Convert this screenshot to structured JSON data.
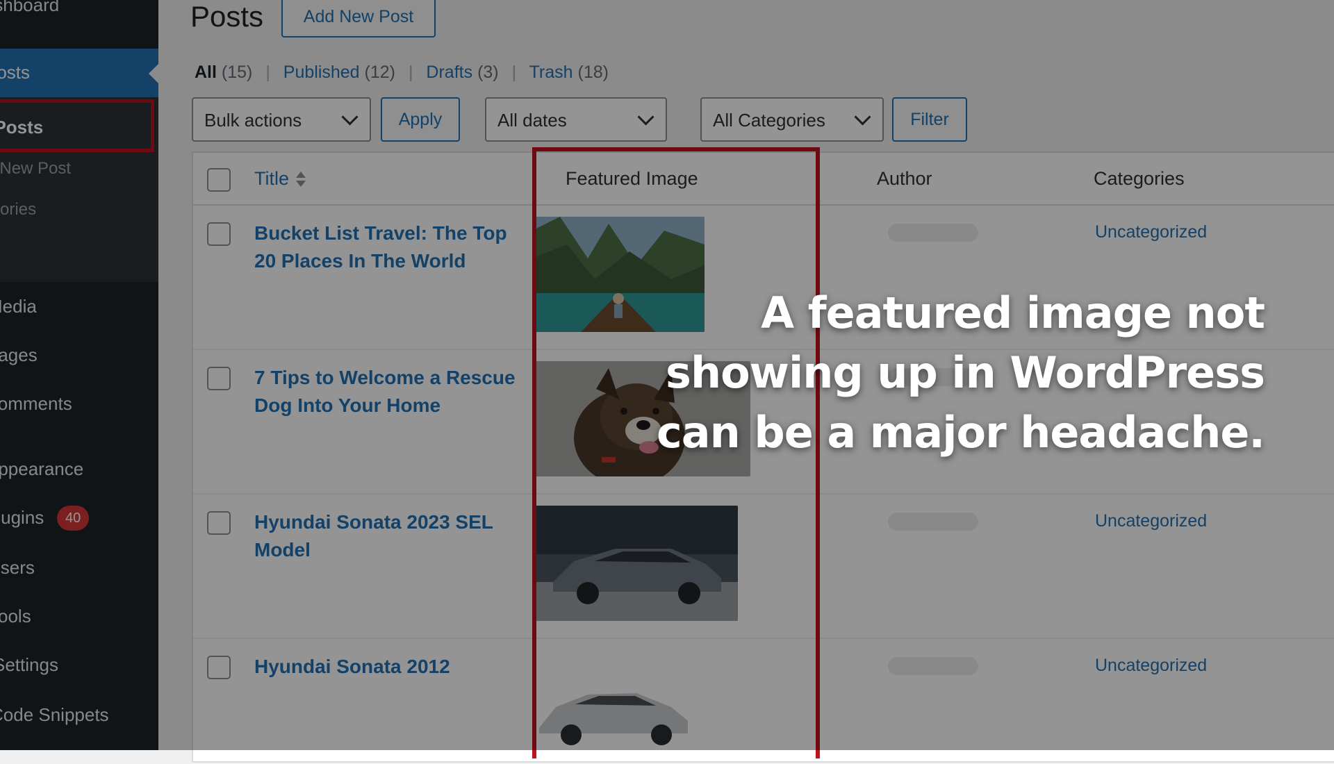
{
  "sidebar": {
    "dashboard": "Dashboard",
    "posts": "Posts",
    "all_posts": "All Posts",
    "add_new_post": "Add New Post",
    "categories": "Categories",
    "media": "Media",
    "pages": "Pages",
    "comments": "Comments",
    "appearance": "Appearance",
    "plugins": "Plugins",
    "plugins_badge": "40",
    "users": "Users",
    "tools": "Tools",
    "settings": "Settings",
    "code_snippets": "Code Snippets"
  },
  "header": {
    "title": "Posts",
    "add_new": "Add New Post"
  },
  "filters": {
    "all": "All",
    "all_count": "(15)",
    "published": "Published",
    "published_count": "(12)",
    "drafts": "Drafts",
    "drafts_count": "(3)",
    "trash": "Trash",
    "trash_count": "(18)",
    "sep": "|"
  },
  "toolbar": {
    "bulk_actions": "Bulk actions",
    "apply": "Apply",
    "all_dates": "All dates",
    "all_categories": "All Categories",
    "filter": "Filter"
  },
  "table": {
    "headers": {
      "title": "Title",
      "featured_image": "Featured Image",
      "author": "Author",
      "categories": "Categories"
    },
    "rows": [
      {
        "title": "Bucket List Travel: The Top 20 Places In The World",
        "category": "Uncategorized"
      },
      {
        "title": "7 Tips to Welcome a Rescue Dog Into Your Home",
        "category": ""
      },
      {
        "title": "Hyundai Sonata 2023 SEL Model",
        "category": "Uncategorized"
      },
      {
        "title": "Hyundai Sonata 2012",
        "category": "Uncategorized"
      }
    ]
  },
  "overlay": {
    "line1": "A featured image not",
    "line2": "showing up in WordPress",
    "line3": "can be a major headache."
  },
  "colors": {
    "accent": "#2271b1",
    "highlight": "#c1121f",
    "sidebar": "#1d2327"
  }
}
